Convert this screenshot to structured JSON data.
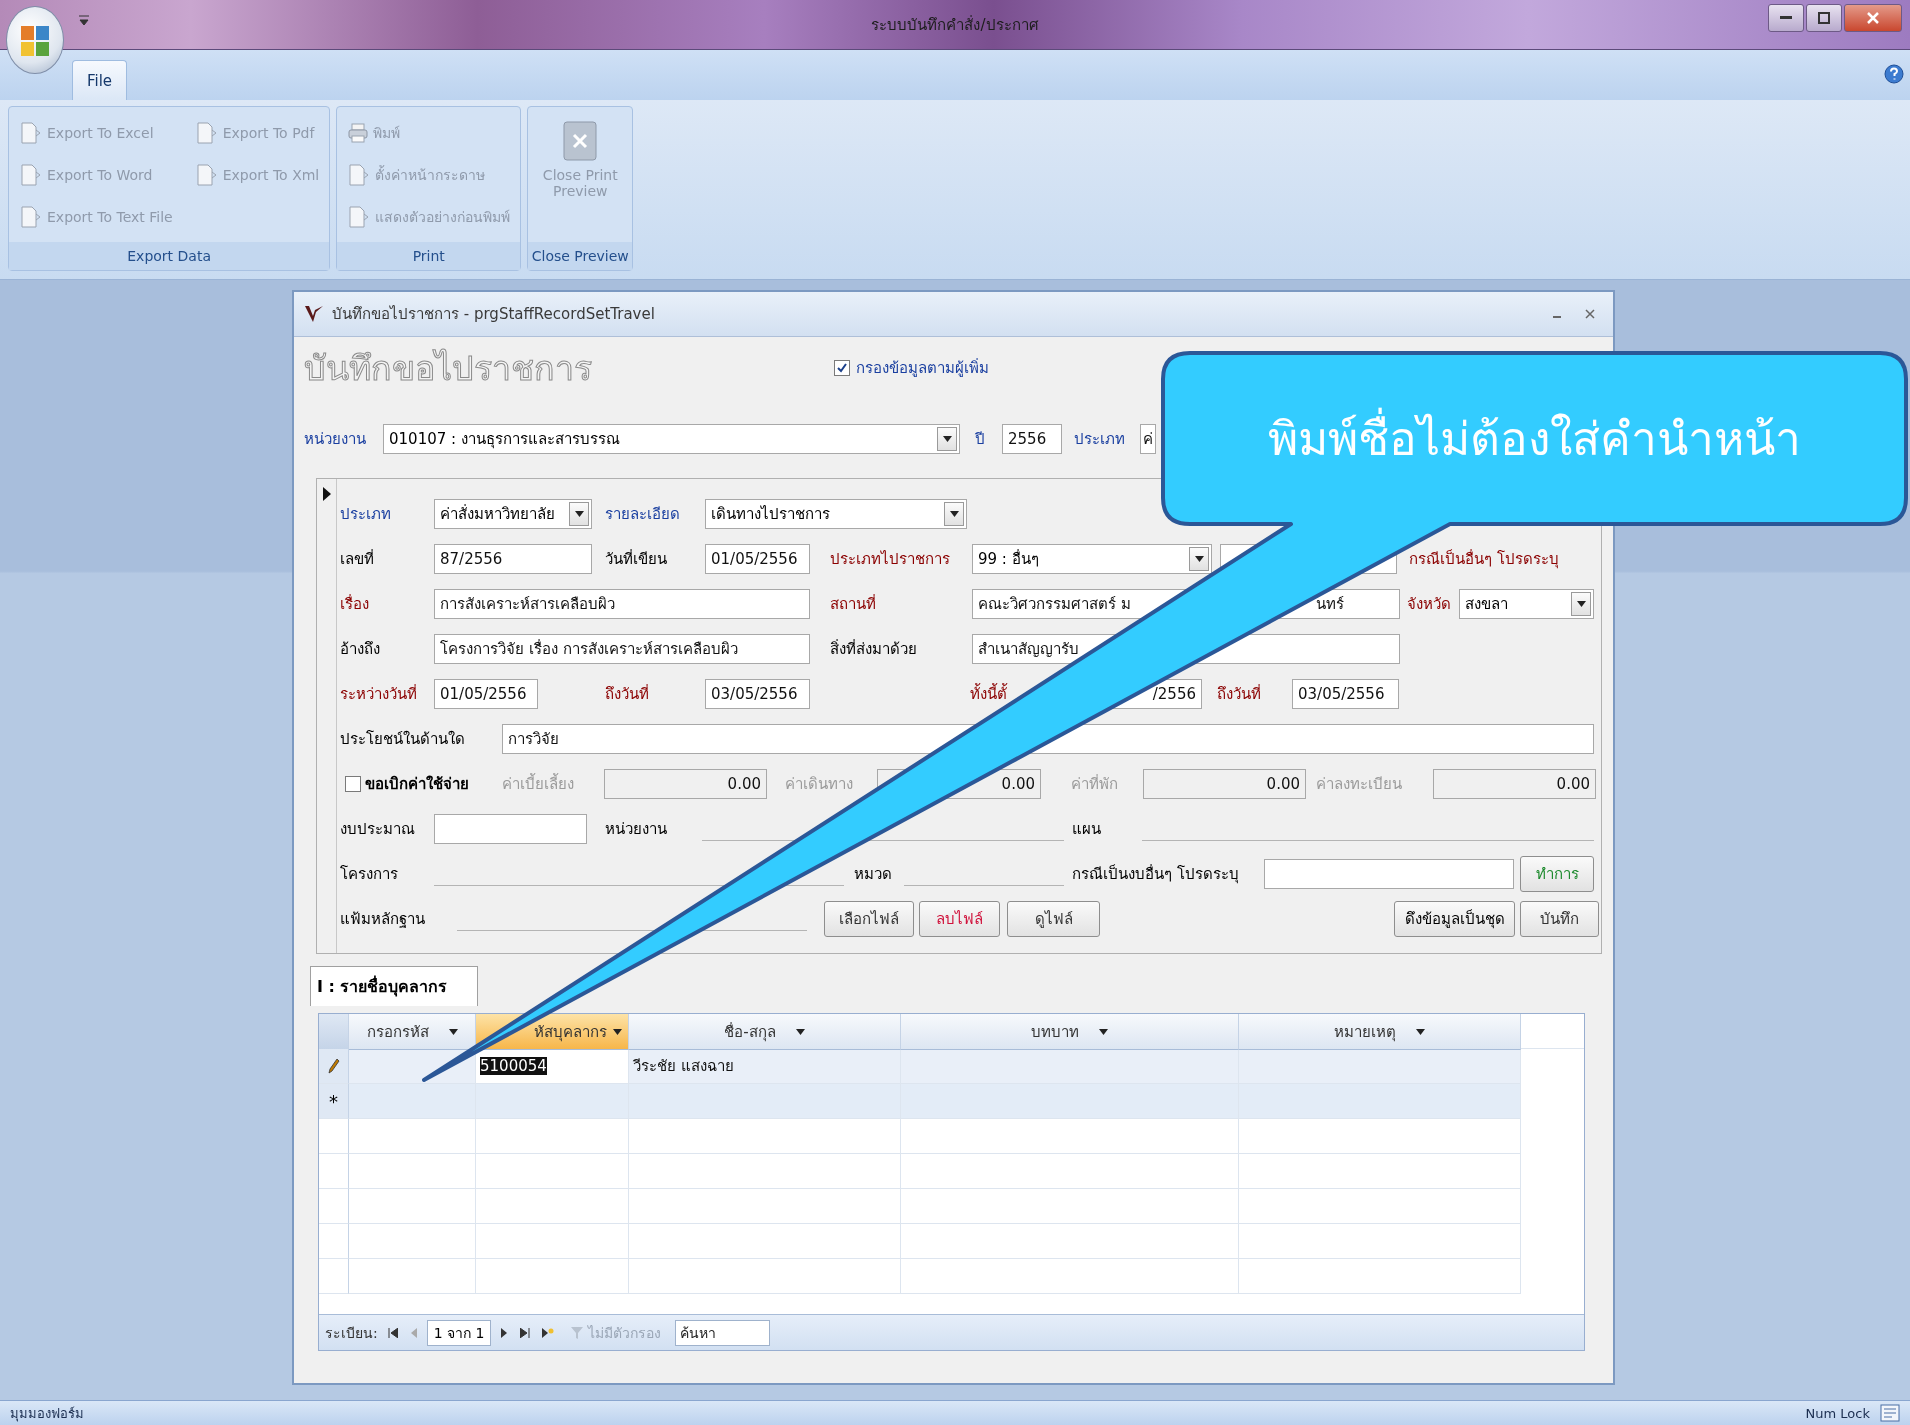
{
  "app": {
    "title": "ระบบบันทึกคำสั่ง/ประกาศ"
  },
  "ribbon": {
    "tabs": [
      {
        "label": "File",
        "selected": true
      }
    ],
    "groups": [
      {
        "name": "Export Data",
        "items": [
          {
            "label": "Export To Excel",
            "disabled": true
          },
          {
            "label": "Export To Pdf",
            "disabled": true
          },
          {
            "label": "Export To Word",
            "disabled": true
          },
          {
            "label": "Export To Xml",
            "disabled": true
          },
          {
            "label": "Export To Text File",
            "disabled": true
          }
        ]
      },
      {
        "name": "Print",
        "items": [
          {
            "label": "พิมพ์",
            "disabled": true
          },
          {
            "label": "ตั้งค่าหน้ากระดาษ",
            "disabled": true
          },
          {
            "label": "แสดงตัวอย่างก่อนพิมพ์",
            "disabled": true
          }
        ]
      },
      {
        "name": "Close Preview",
        "items": [
          {
            "label": "Close Print Preview",
            "disabled": true
          }
        ]
      }
    ]
  },
  "form_window": {
    "title": "บันทึกขอไปราชการ - prgStaffRecordSetTravel",
    "heading": "บันทึกขอไปราชการ",
    "filter": {
      "label": "กรองข้อมูลตามผู้เพิ่ม",
      "checked": true
    },
    "header_fields": [
      {
        "kind": "label",
        "text": "หน่วยงาน",
        "color": "#1a3fa0"
      },
      {
        "kind": "combo",
        "value": "010107 : งานธุรการและสารบรรณ"
      },
      {
        "kind": "label",
        "text": "ปี",
        "color": "#1a3fa0"
      },
      {
        "kind": "field",
        "value": "2556",
        "disabled": false
      },
      {
        "kind": "label",
        "text": "ประเภท",
        "color": "#1a3fa0"
      },
      {
        "kind": "field",
        "value": "ค่",
        "disabled": false
      }
    ],
    "detail_rows": [
      {
        "items": [
          {
            "kind": "label",
            "text": "ประเภท",
            "color": "#1a3fa0"
          },
          {
            "kind": "combo",
            "value": "ค่าสั่งมหาวิทยาลัย"
          },
          {
            "kind": "label",
            "text": "รายละเอียด",
            "color": "#1a3fa0"
          },
          {
            "kind": "combo",
            "value": "เดินทางไปราชการ"
          }
        ]
      },
      {
        "items": [
          {
            "kind": "label",
            "text": "เลขที่",
            "color": "#000000"
          },
          {
            "kind": "field",
            "value": "87/2556",
            "disabled": false
          },
          {
            "kind": "label",
            "text": "วันที่เขียน",
            "color": "#000000"
          },
          {
            "kind": "field",
            "value": "01/05/2556",
            "disabled": false
          },
          {
            "kind": "label",
            "text": "ประเภทไปราชการ",
            "color": "#8b0000"
          },
          {
            "kind": "combo",
            "value": "99 : อื่นๆ"
          },
          {
            "kind": "field",
            "disabled": false
          },
          {
            "kind": "label",
            "text": "กรณีเป็นอื่นๆ โปรดระบุ",
            "color": "#8b0000"
          }
        ]
      },
      {
        "items": [
          {
            "kind": "label",
            "text": "เรื่อง",
            "color": "#8b0000"
          },
          {
            "kind": "field",
            "value": "การสังเคราะห์สารเคลือบผิว",
            "disabled": false
          },
          {
            "kind": "label",
            "text": "สถานที่",
            "color": "#8b0000"
          },
          {
            "kind": "field",
            "value_fragments": [
              "คณะวิศวกรรมศาสตร์ ม",
              "นทร์"
            ],
            "disabled": false
          },
          {
            "kind": "label",
            "text": "จังหวัด",
            "color": "#8b0000"
          },
          {
            "kind": "combo",
            "value": "สงขลา"
          }
        ]
      },
      {
        "items": [
          {
            "kind": "label",
            "text": "อ้างถึง",
            "color": "#000000"
          },
          {
            "kind": "field",
            "value": "โครงการวิจัย เรื่อง การสังเคราะห์สารเคลือบผิว",
            "disabled": false
          },
          {
            "kind": "label",
            "text": "สิ่งที่ส่งมาด้วย",
            "color": "#000000"
          },
          {
            "kind": "field",
            "value": "สำเนาสัญญารับ",
            "disabled": false
          }
        ]
      },
      {
        "items": [
          {
            "kind": "label",
            "text": "ระหว่างวันที่",
            "color": "#8b0000"
          },
          {
            "kind": "field",
            "value": "01/05/2556",
            "disabled": false
          },
          {
            "kind": "label",
            "text": "ถึงวันที่",
            "color": "#8b0000"
          },
          {
            "kind": "field",
            "value": "03/05/2556",
            "disabled": false
          },
          {
            "kind": "label",
            "text": "ทั้งนี้ตั้",
            "color": "#8b0000"
          },
          {
            "kind": "field",
            "value": "/2556",
            "disabled": false
          },
          {
            "kind": "label",
            "text": "ถึงวันที่",
            "color": "#8b0000"
          },
          {
            "kind": "field",
            "value": "03/05/2556",
            "disabled": false
          }
        ]
      },
      {
        "items": [
          {
            "kind": "label",
            "text": "ประโยชน์ในด้านใด",
            "color": "#000000"
          },
          {
            "kind": "field",
            "value": "การวิจัย",
            "disabled": false
          }
        ]
      },
      {
        "items": [
          {
            "kind": "check",
            "label": "ขอเบิกค่าใช้จ่าย",
            "checked": false
          },
          {
            "kind": "label",
            "text": "ค่าเบี้ยเลี้ยง",
            "color": "#9a9a9a"
          },
          {
            "kind": "field",
            "value": "0.00",
            "disabled": true
          },
          {
            "kind": "label",
            "text": "ค่าเดินทาง",
            "color": "#9a9a9a"
          },
          {
            "kind": "field",
            "value": "0.00",
            "disabled": true
          },
          {
            "kind": "label",
            "text": "ค่าที่พัก",
            "color": "#9a9a9a"
          },
          {
            "kind": "field",
            "value": "0.00",
            "disabled": true
          },
          {
            "kind": "label",
            "text": "ค่าลงทะเบียน",
            "color": "#9a9a9a"
          },
          {
            "kind": "field",
            "value": "0.00",
            "disabled": true
          }
        ]
      },
      {
        "items": [
          {
            "kind": "label",
            "text": "งบประมาณ",
            "color": "#000000"
          },
          {
            "kind": "field",
            "disabled": false
          },
          {
            "kind": "label",
            "text": "หน่วยงาน",
            "color": "#000000"
          },
          {
            "kind": "line"
          },
          {
            "kind": "label",
            "text": "แผน",
            "color": "#000000"
          },
          {
            "kind": "line"
          }
        ]
      },
      {
        "items": [
          {
            "kind": "label",
            "text": "โครงการ",
            "color": "#000000"
          },
          {
            "kind": "line"
          },
          {
            "kind": "label",
            "text": "หมวด",
            "color": "#000000"
          },
          {
            "kind": "line"
          },
          {
            "kind": "label",
            "text": "กรณีเป็นงบอื่นๆ โปรดระบุ",
            "color": "#000000"
          },
          {
            "kind": "field",
            "disabled": false
          },
          {
            "kind": "button",
            "label": "ทำการ",
            "color": "#1e8a2e"
          }
        ]
      },
      {
        "items": [
          {
            "kind": "label",
            "text": "แฟ้มหลักฐาน",
            "color": "#000000"
          },
          {
            "kind": "line"
          },
          {
            "kind": "button",
            "label": "เลือกไฟล์",
            "color": "#333333"
          },
          {
            "kind": "button",
            "label": "ลบไฟล์",
            "color": "#d0103a"
          },
          {
            "kind": "button",
            "label": "ดูไฟล์",
            "color": "#333333"
          },
          {
            "kind": "button",
            "label": "ดึงข้อมูลเป็นชุด",
            "color": "#000000"
          },
          {
            "kind": "button",
            "label": "บันทึก",
            "color": "#333333"
          }
        ]
      }
    ],
    "subform": {
      "tab": {
        "label": "I : รายชื่อบุคลากร",
        "selected": true
      },
      "columns": [
        {
          "label": "กรอกรหัส",
          "selected": false
        },
        {
          "label": "หัสบุคลากร",
          "selected": true
        },
        {
          "label": "ชื่อ-สกุล",
          "selected": false
        },
        {
          "label": "บทบาท",
          "selected": false
        },
        {
          "label": "หมายเหตุ",
          "selected": false
        }
      ],
      "rows": [
        {
          "kind": "editing",
          "cells": [
            {
              "selected": false
            },
            {
              "text": "5100054",
              "selected": true
            },
            {
              "text": "วีระชัย  แสงฉาย",
              "selected": false
            },
            {
              "selected": false
            },
            {
              "selected": false
            }
          ]
        },
        {
          "kind": "new",
          "selector": "*"
        }
      ],
      "navigator": {
        "label": "ระเบียน:",
        "position": "1 จาก 1",
        "filter": "ไม่มีตัวกรอง",
        "search_placeholder": "ค้นหา"
      }
    }
  },
  "callout": {
    "text": "พิมพ์ชื่อไม่ต้องใส่คำนำหน้า"
  },
  "status_bar": {
    "left": "มุมมองฟอร์ม",
    "right": "Num Lock"
  }
}
